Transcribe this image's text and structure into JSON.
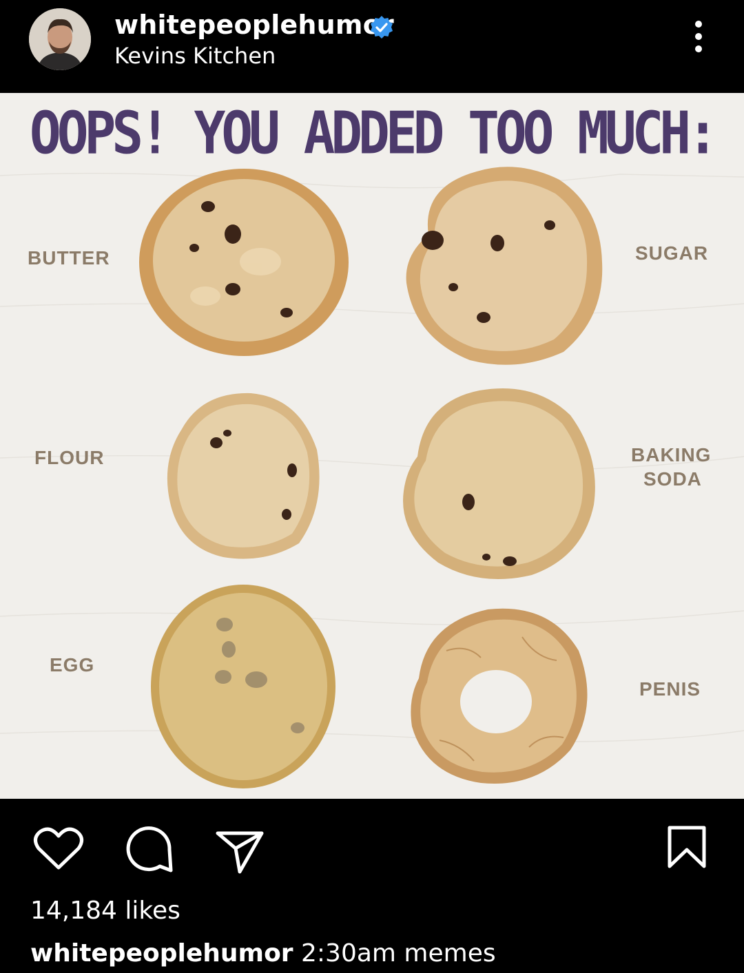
{
  "header": {
    "username": "whitepeoplehumor",
    "subtitle": "Kevins Kitchen",
    "icons": [
      "avatar",
      "verified-badge-icon",
      "more-options-icon"
    ],
    "verified_color": "#3897f0"
  },
  "post": {
    "title": "OOPS! YOU ADDED TOO MUCH:",
    "title_color": "#4c3a6b",
    "label_color": "#8b7b68",
    "labels": {
      "butter": "BUTTER",
      "sugar": "SUGAR",
      "flour": "FLOUR",
      "baking": "BAKING",
      "soda": "SODA",
      "egg": "EGG",
      "penis": "PENIS"
    }
  },
  "actions": {
    "icons": [
      "heart-icon",
      "comment-icon",
      "share-icon",
      "bookmark-icon"
    ],
    "likes": "14,184 likes",
    "caption_user": "whitepeoplehumor",
    "caption_text": " 2:30am memes"
  }
}
